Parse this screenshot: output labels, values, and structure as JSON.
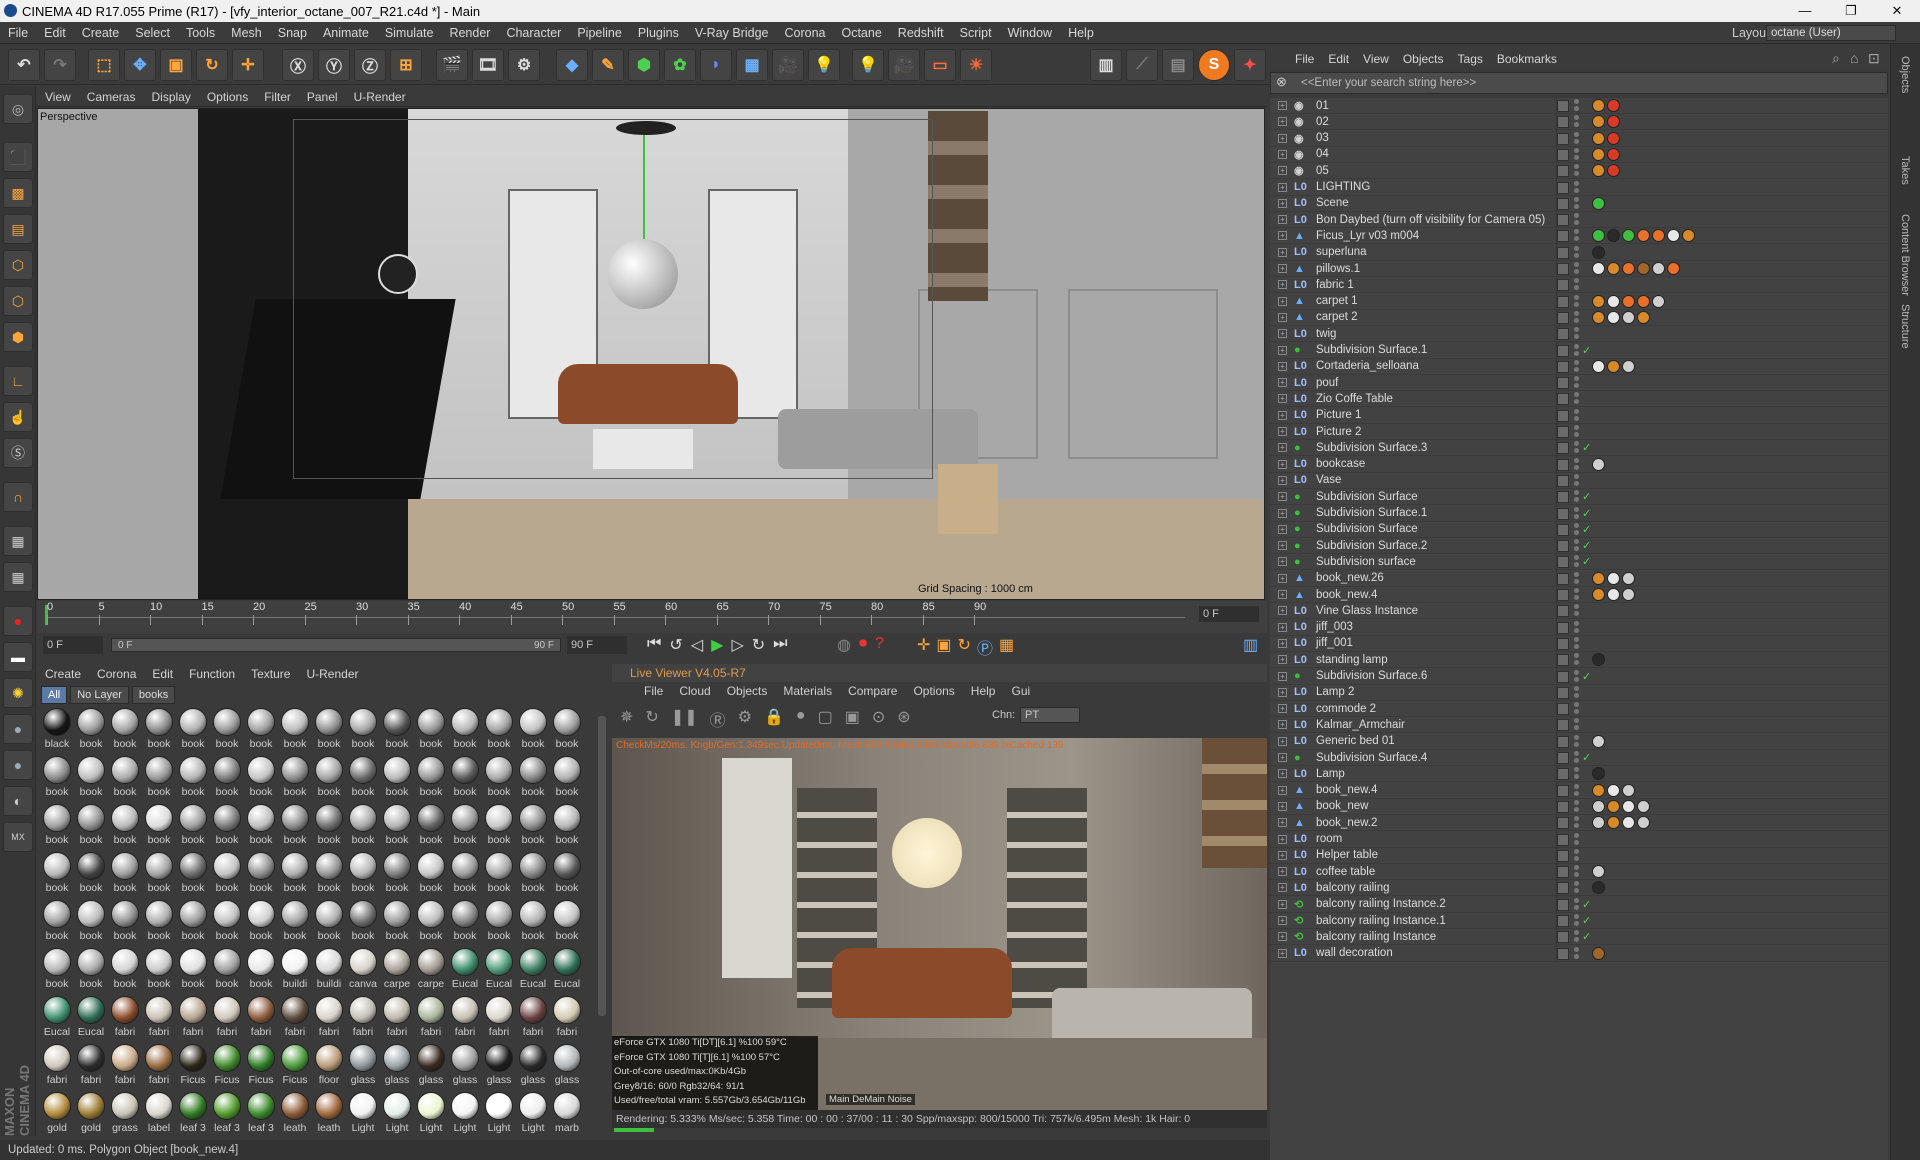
{
  "window": {
    "title": "CINEMA 4D R17.055 Prime (R17) - [vfy_interior_octane_007_R21.c4d *] - Main"
  },
  "menubar": [
    "File",
    "Edit",
    "Create",
    "Select",
    "Tools",
    "Mesh",
    "Snap",
    "Animate",
    "Simulate",
    "Render",
    "Character",
    "Pipeline",
    "Plugins",
    "V-Ray Bridge",
    "Corona",
    "Octane",
    "Redshift",
    "Script",
    "Window",
    "Help"
  ],
  "layout": {
    "label": "Layout:",
    "value": "octane (User)"
  },
  "viewport": {
    "menu": [
      "View",
      "Cameras",
      "Display",
      "Options",
      "Filter",
      "Panel",
      "U-Render"
    ],
    "name": "Perspective",
    "grid_spacing": "Grid Spacing : 1000 cm"
  },
  "timeline": {
    "ticks": [
      "0",
      "5",
      "10",
      "15",
      "20",
      "25",
      "30",
      "35",
      "40",
      "45",
      "50",
      "55",
      "60",
      "65",
      "70",
      "75",
      "80",
      "85",
      "90"
    ],
    "current": "0 F",
    "start": "0 F",
    "range_start": "0 F",
    "range_end": "90 F",
    "end": "90 F"
  },
  "materials": {
    "menu": [
      "Create",
      "Corona",
      "Edit",
      "Function",
      "Texture",
      "U-Render"
    ],
    "filters": [
      "All",
      "No Layer",
      "books"
    ],
    "items": [
      {
        "n": "black",
        "c": "#151515"
      },
      {
        "n": "book",
        "c": "#9a9a9a"
      },
      {
        "n": "book",
        "c": "#a5a5a5"
      },
      {
        "n": "book",
        "c": "#8c8c8c"
      },
      {
        "n": "book",
        "c": "#b0b0b0"
      },
      {
        "n": "book",
        "c": "#999"
      },
      {
        "n": "book",
        "c": "#a0a0a0"
      },
      {
        "n": "book",
        "c": "#bcbcbc"
      },
      {
        "n": "book",
        "c": "#8e8e8e"
      },
      {
        "n": "book",
        "c": "#a8a8a8"
      },
      {
        "n": "book",
        "c": "#555"
      },
      {
        "n": "book",
        "c": "#979797"
      },
      {
        "n": "book",
        "c": "#b6b6b6"
      },
      {
        "n": "book",
        "c": "#a2a2a2"
      },
      {
        "n": "book",
        "c": "#c2c2c2"
      },
      {
        "n": "book",
        "c": "#9d9d9d"
      },
      {
        "n": "book",
        "c": "#8a8a8a"
      },
      {
        "n": "book",
        "c": "#bdbdbd"
      },
      {
        "n": "book",
        "c": "#aaa"
      },
      {
        "n": "book",
        "c": "#999"
      },
      {
        "n": "book",
        "c": "#b4b4b4"
      },
      {
        "n": "book",
        "c": "#7e7e7e"
      },
      {
        "n": "book",
        "c": "#c5c5c5"
      },
      {
        "n": "book",
        "c": "#8d8d8d"
      },
      {
        "n": "book",
        "c": "#a3a3a3"
      },
      {
        "n": "book",
        "c": "#6a6a6a"
      },
      {
        "n": "book",
        "c": "#b9b9b9"
      },
      {
        "n": "book",
        "c": "#959595"
      },
      {
        "n": "book",
        "c": "#5a5a5a"
      },
      {
        "n": "book",
        "c": "#a9a9a9"
      },
      {
        "n": "book",
        "c": "#878787"
      },
      {
        "n": "book",
        "c": "#b1b1b1"
      },
      {
        "n": "book",
        "c": "#a0a0a0"
      },
      {
        "n": "book",
        "c": "#909090"
      },
      {
        "n": "book",
        "c": "#bababa"
      },
      {
        "n": "book",
        "c": "#dcdcdc"
      },
      {
        "n": "book",
        "c": "#9f9f9f"
      },
      {
        "n": "book",
        "c": "#7a7a7a"
      },
      {
        "n": "book",
        "c": "#c0c0c0"
      },
      {
        "n": "book",
        "c": "#8b8b8b"
      },
      {
        "n": "book",
        "c": "#6f6f6f"
      },
      {
        "n": "book",
        "c": "#a6a6a6"
      },
      {
        "n": "book",
        "c": "#b3b3b3"
      },
      {
        "n": "book",
        "c": "#636363"
      },
      {
        "n": "book",
        "c": "#9c9c9c"
      },
      {
        "n": "book",
        "c": "#c8c8c8"
      },
      {
        "n": "book",
        "c": "#8f8f8f"
      },
      {
        "n": "book",
        "c": "#b7b7b7"
      },
      {
        "n": "book",
        "c": "#b8b8b8"
      },
      {
        "n": "book",
        "c": "#444"
      },
      {
        "n": "book",
        "c": "#9e9e9e"
      },
      {
        "n": "book",
        "c": "#a4a4a4"
      },
      {
        "n": "book",
        "c": "#6c6c6c"
      },
      {
        "n": "book",
        "c": "#c3c3c3"
      },
      {
        "n": "book",
        "c": "#8d8d8d"
      },
      {
        "n": "book",
        "c": "#adadad"
      },
      {
        "n": "book",
        "c": "#959595"
      },
      {
        "n": "book",
        "c": "#b5b5b5"
      },
      {
        "n": "book",
        "c": "#7c7c7c"
      },
      {
        "n": "book",
        "c": "#c6c6c6"
      },
      {
        "n": "book",
        "c": "#9b9b9b"
      },
      {
        "n": "book",
        "c": "#a7a7a7"
      },
      {
        "n": "book",
        "c": "#868686"
      },
      {
        "n": "book",
        "c": "#575757"
      },
      {
        "n": "book",
        "c": "#a1a1a1"
      },
      {
        "n": "book",
        "c": "#bbbbbb"
      },
      {
        "n": "book",
        "c": "#8f8f8f"
      },
      {
        "n": "book",
        "c": "#aeaeae"
      },
      {
        "n": "book",
        "c": "#999"
      },
      {
        "n": "book",
        "c": "#c1c1c1"
      },
      {
        "n": "book",
        "c": "#d0d0d0"
      },
      {
        "n": "book",
        "c": "#a3a3a3"
      },
      {
        "n": "book",
        "c": "#b0b0b0"
      },
      {
        "n": "book",
        "c": "#6e6e6e"
      },
      {
        "n": "book",
        "c": "#9a9a9a"
      },
      {
        "n": "book",
        "c": "#bcbcbc"
      },
      {
        "n": "book",
        "c": "#858585"
      },
      {
        "n": "book",
        "c": "#a8a8a8"
      },
      {
        "n": "book",
        "c": "#b2b2b2"
      },
      {
        "n": "book",
        "c": "#c4c4c4"
      },
      {
        "n": "book",
        "c": "#b6b6b6"
      },
      {
        "n": "book",
        "c": "#a9a9a9"
      },
      {
        "n": "book",
        "c": "#d4d4d4"
      },
      {
        "n": "book",
        "c": "#c9c9c9"
      },
      {
        "n": "book",
        "c": "#e0e0e0"
      },
      {
        "n": "book",
        "c": "#a0a0a0"
      },
      {
        "n": "book",
        "c": "#e8e8e8"
      },
      {
        "n": "buildi",
        "c": "#f2f2f2"
      },
      {
        "n": "buildi",
        "c": "#d8d8d8"
      },
      {
        "n": "canva",
        "c": "#d6d2c8"
      },
      {
        "n": "carpe",
        "c": "#a9a197"
      },
      {
        "n": "carpe",
        "c": "#9f988e"
      },
      {
        "n": "Eucal",
        "c": "#3a8a6a"
      },
      {
        "n": "Eucal",
        "c": "#4f9a78"
      },
      {
        "n": "Eucal",
        "c": "#3c7d60"
      },
      {
        "n": "Eucal",
        "c": "#2f6f55"
      },
      {
        "n": "Eucal",
        "c": "#3d8e6c"
      },
      {
        "n": "Eucal",
        "c": "#2d6b52"
      },
      {
        "n": "fabri",
        "c": "#8a4a2a"
      },
      {
        "n": "fabri",
        "c": "#c9c0b4"
      },
      {
        "n": "fabri",
        "c": "#b7a590"
      },
      {
        "n": "fabri",
        "c": "#d0c6ba"
      },
      {
        "n": "fabri",
        "c": "#8b5a3a"
      },
      {
        "n": "fabri",
        "c": "#5e4a3c"
      },
      {
        "n": "fabri",
        "c": "#d9d3ca"
      },
      {
        "n": "fabri",
        "c": "#c2bdb5"
      },
      {
        "n": "fabri",
        "c": "#bfb8ab"
      },
      {
        "n": "fabri",
        "c": "#a9b49a"
      },
      {
        "n": "fabri",
        "c": "#c6bfb3"
      },
      {
        "n": "fabri",
        "c": "#dcd6cc"
      },
      {
        "n": "fabri",
        "c": "#6a4040"
      },
      {
        "n": "fabri",
        "c": "#d4c9b2"
      },
      {
        "n": "fabri",
        "c": "#cfc7bb"
      },
      {
        "n": "fabri",
        "c": "#2c2c2c"
      },
      {
        "n": "fabri",
        "c": "#c9a987"
      },
      {
        "n": "fabri",
        "c": "#9a6a40"
      },
      {
        "n": "Ficus",
        "c": "#2a2418"
      },
      {
        "n": "Ficus",
        "c": "#3f8a2a"
      },
      {
        "n": "Ficus",
        "c": "#2f7a25"
      },
      {
        "n": "Ficus",
        "c": "#4a9a3a"
      },
      {
        "n": "floor",
        "c": "#b99a78"
      },
      {
        "n": "glass",
        "c": "#8f979c"
      },
      {
        "n": "glass",
        "c": "#9aa3a8"
      },
      {
        "n": "glass",
        "c": "#3a2a20"
      },
      {
        "n": "glass",
        "c": "#a0a0a0"
      },
      {
        "n": "glass",
        "c": "#1e1e1e"
      },
      {
        "n": "glass",
        "c": "#2a2a2a"
      },
      {
        "n": "glass",
        "c": "#b0b6b9"
      },
      {
        "n": "gold",
        "c": "#b28a3a"
      },
      {
        "n": "gold",
        "c": "#9a7a30"
      },
      {
        "n": "grass",
        "c": "#c9c3b5"
      },
      {
        "n": "label",
        "c": "#d9d5cc"
      },
      {
        "n": "leaf 3",
        "c": "#2f7a22"
      },
      {
        "n": "leaf 3",
        "c": "#4f9a2a"
      },
      {
        "n": "leaf 3",
        "c": "#3a8a2a"
      },
      {
        "n": "leath",
        "c": "#8a5a34"
      },
      {
        "n": "leath",
        "c": "#a0663a"
      },
      {
        "n": "Light",
        "c": "#f2f2f2"
      },
      {
        "n": "Light",
        "c": "#e4efe8"
      },
      {
        "n": "Light",
        "c": "#eaf5d0"
      },
      {
        "n": "Light",
        "c": "#f4f4f4"
      },
      {
        "n": "Light",
        "c": "#ffffff"
      },
      {
        "n": "Light",
        "c": "#ededed"
      },
      {
        "n": "marb",
        "c": "#d8d8d8"
      }
    ]
  },
  "live_viewer": {
    "title": "Live Viewer V4.05-R7",
    "menu": [
      "File",
      "Cloud",
      "Objects",
      "Materials",
      "Compare",
      "Options",
      "Help",
      "Gui"
    ],
    "channel_label": "Chn:",
    "channel_value": "PT",
    "overlay": "CheckMs/20ms. Kngb/Gen:1.349sec.Update0ms. Mesh:839 Nodes:3863 Movable:839 txCached:139",
    "gpu1": "eForce GTX 1080 Ti[DT][6.1]  %100   59°C",
    "gpu2": "eForce GTX 1080 Ti[T][6.1]  %100   57°C",
    "ooc": "Out-of-core used/max:0Kb/4Gb",
    "grey": "Grey8/16: 60/0        Rgb32/64: 91/1",
    "vram": "Used/free/total vram: 5.557Gb/3.654Gb/11Gb",
    "tabs": "Main  DeMain  Noise",
    "status": "Rendering: 5.333%   Ms/sec: 5.358   Time: 00 : 00 : 37/00 : 11 : 30   Spp/maxspp: 800/15000    Tri: 757k/6.495m   Mesh: 1k    Hair: 0"
  },
  "status_bar": "Updated: 0 ms.     Polygon Object [book_new.4]",
  "objects": {
    "menu": [
      "File",
      "Edit",
      "View",
      "Objects",
      "Tags",
      "Bookmarks"
    ],
    "search_placeholder": "<<Enter your search string here>>",
    "rows": [
      {
        "n": "01",
        "i": "cam",
        "t": [
          "o",
          "r"
        ]
      },
      {
        "n": "02",
        "i": "cam",
        "t": [
          "o",
          "r"
        ]
      },
      {
        "n": "03",
        "i": "cam",
        "t": [
          "o",
          "r"
        ]
      },
      {
        "n": "04",
        "i": "cam",
        "t": [
          "o",
          "r"
        ]
      },
      {
        "n": "05",
        "i": "cam",
        "t": [
          "o",
          "r"
        ]
      },
      {
        "n": "LIGHTING",
        "i": "null",
        "t": []
      },
      {
        "n": "Scene",
        "i": "null",
        "t": [
          "g"
        ]
      },
      {
        "n": "Bon Daybed (turn off visibility for Camera 05)",
        "i": "null",
        "t": []
      },
      {
        "n": "Ficus_Lyr v03 m004",
        "i": "poly",
        "t": [
          "g",
          "d",
          "g",
          "t",
          "t",
          "c",
          "o"
        ]
      },
      {
        "n": "superluna",
        "i": "null",
        "t": [
          "d"
        ]
      },
      {
        "n": "pillows.1",
        "i": "poly",
        "t": [
          "c",
          "o",
          "t",
          "b",
          "w",
          "t"
        ]
      },
      {
        "n": "fabric 1",
        "i": "null",
        "t": []
      },
      {
        "n": "carpet 1",
        "i": "poly",
        "t": [
          "o",
          "c",
          "t",
          "t",
          "w"
        ]
      },
      {
        "n": "carpet 2",
        "i": "poly",
        "t": [
          "o",
          "c",
          "w",
          "o"
        ]
      },
      {
        "n": "twig",
        "i": "null",
        "t": []
      },
      {
        "n": "Subdivision Surface.1",
        "i": "sds",
        "t": [],
        "k": true
      },
      {
        "n": "Cortaderia_selloana",
        "i": "null",
        "t": [
          "c",
          "o",
          "w"
        ]
      },
      {
        "n": "pouf",
        "i": "null",
        "t": []
      },
      {
        "n": "Zio Coffe Table",
        "i": "null",
        "t": []
      },
      {
        "n": "Picture 1",
        "i": "null",
        "t": []
      },
      {
        "n": "Picture 2",
        "i": "null",
        "t": []
      },
      {
        "n": "Subdivision Surface.3",
        "i": "sds",
        "t": [],
        "k": true
      },
      {
        "n": "bookcase",
        "i": "null",
        "t": [
          "w"
        ]
      },
      {
        "n": "Vase",
        "i": "null",
        "t": []
      },
      {
        "n": "Subdivision Surface",
        "i": "sds",
        "t": [],
        "k": true
      },
      {
        "n": "Subdivision Surface.1",
        "i": "sds",
        "t": [],
        "k": true
      },
      {
        "n": "Subdivision Surface",
        "i": "sds",
        "t": [],
        "k": true
      },
      {
        "n": "Subdivision Surface.2",
        "i": "sds",
        "t": [],
        "k": true
      },
      {
        "n": "Subdivision surface",
        "i": "sds",
        "t": [],
        "k": true
      },
      {
        "n": "book_new.26",
        "i": "poly",
        "t": [
          "o",
          "c",
          "w"
        ]
      },
      {
        "n": "book_new.4",
        "i": "poly",
        "t": [
          "o",
          "c",
          "w"
        ]
      },
      {
        "n": "Vine Glass Instance",
        "i": "null",
        "t": []
      },
      {
        "n": "jiff_003",
        "i": "null",
        "t": []
      },
      {
        "n": "jiff_001",
        "i": "null",
        "t": []
      },
      {
        "n": "standing lamp",
        "i": "null",
        "t": [
          "d"
        ]
      },
      {
        "n": "Subdivision Surface.6",
        "i": "sds",
        "t": [],
        "k": true
      },
      {
        "n": "Lamp 2",
        "i": "null",
        "t": []
      },
      {
        "n": "commode 2",
        "i": "null",
        "t": []
      },
      {
        "n": "Kalmar_Armchair",
        "i": "null",
        "t": []
      },
      {
        "n": "Generic bed 01",
        "i": "null",
        "t": [
          "w"
        ]
      },
      {
        "n": "Subdivision Surface.4",
        "i": "sds",
        "t": [],
        "k": true
      },
      {
        "n": "Lamp",
        "i": "null",
        "t": [
          "d"
        ]
      },
      {
        "n": "book_new.4",
        "i": "poly",
        "t": [
          "o",
          "c",
          "w"
        ]
      },
      {
        "n": "book_new",
        "i": "poly",
        "t": [
          "w",
          "o",
          "c",
          "w"
        ]
      },
      {
        "n": "book_new.2",
        "i": "poly",
        "t": [
          "w",
          "o",
          "c",
          "w"
        ]
      },
      {
        "n": "room",
        "i": "null",
        "t": []
      },
      {
        "n": "Helper table",
        "i": "null",
        "t": []
      },
      {
        "n": "coffee table",
        "i": "null",
        "t": [
          "w"
        ]
      },
      {
        "n": "balcony railing",
        "i": "null",
        "t": [
          "d"
        ]
      },
      {
        "n": "balcony railing Instance.2",
        "i": "inst",
        "t": [],
        "k": true
      },
      {
        "n": "balcony railing Instance.1",
        "i": "inst",
        "t": [],
        "k": true
      },
      {
        "n": "balcony railing Instance",
        "i": "inst",
        "t": [],
        "k": true
      },
      {
        "n": "wall decoration",
        "i": "null",
        "t": [
          "b"
        ]
      }
    ]
  },
  "right_tabs": [
    "Objects",
    "Takes",
    "Content Browser",
    "Structure"
  ],
  "colors": {
    "accent": "#ffa53a",
    "bg": "#3a3a3a",
    "live_title": "#e09a4a"
  }
}
